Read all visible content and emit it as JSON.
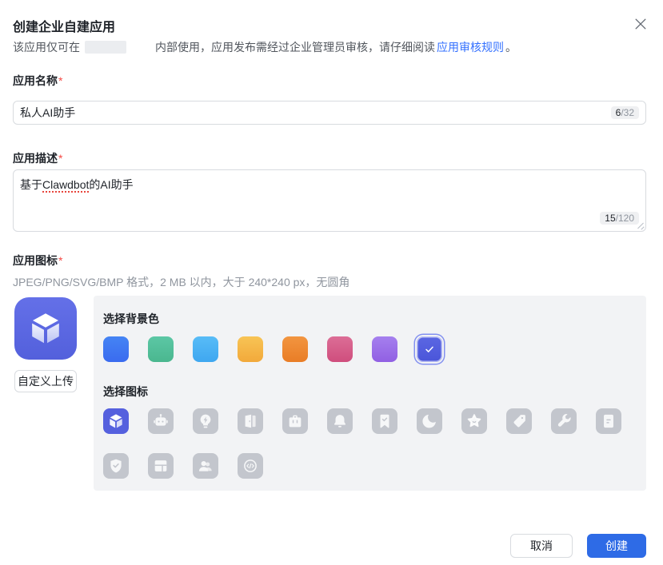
{
  "header": {
    "title": "创建企业自建应用",
    "subtitle_prefix": "该应用仅可在",
    "subtitle_suffix": "内部使用，应用发布需经过企业管理员审核，请仔细阅读",
    "subtitle_link": "应用审核规则",
    "subtitle_period": "。"
  },
  "name_field": {
    "label": "应用名称",
    "required": "*",
    "value": "私人AI助手",
    "count": "6",
    "limit": "/32"
  },
  "desc_field": {
    "label": "应用描述",
    "required": "*",
    "value_before": "基于",
    "value_marked": "Clawdbot",
    "value_after": "的AI助手",
    "count": "15",
    "limit": "/120"
  },
  "icon_field": {
    "label": "应用图标",
    "required": "*",
    "hint": "JPEG/PNG/SVG/BMP 格式，2 MB 以内，大于 240*240 px，无圆角",
    "upload_button": "自定义上传",
    "preview_icon": "cube-icon"
  },
  "picker": {
    "bg_color_title": "选择背景色",
    "icon_title": "选择图标",
    "colors": [
      {
        "name": "blue",
        "from": "#4584f4",
        "to": "#3a6bef"
      },
      {
        "name": "green",
        "from": "#5cc7a5",
        "to": "#4ab78f"
      },
      {
        "name": "sky",
        "from": "#58bcf7",
        "to": "#3fa7f0"
      },
      {
        "name": "amber",
        "from": "#f8c455",
        "to": "#f2a93b"
      },
      {
        "name": "orange",
        "from": "#f29540",
        "to": "#e97d26"
      },
      {
        "name": "rose",
        "from": "#dc6d96",
        "to": "#cf4e7d"
      },
      {
        "name": "purple",
        "from": "#a580ee",
        "to": "#9160e3"
      },
      {
        "name": "indigo",
        "from": "#5b67e3",
        "to": "#4a55d9"
      }
    ],
    "selected_color_index": 7,
    "check_icon": "check-icon",
    "icons": [
      "cube",
      "robot",
      "bulb",
      "door",
      "briefcase",
      "bell",
      "bookmark-check",
      "moon",
      "star",
      "tag",
      "wrench",
      "document",
      "shield-check",
      "layout",
      "users",
      "code"
    ],
    "selected_icon_index": 0
  },
  "footer": {
    "cancel_label": "取消",
    "create_label": "创建"
  },
  "colors": {
    "accent_blue": "#3370ff",
    "create_button": "#2e6be6",
    "selected_tile": "#5560de",
    "tile_grey": "#c3c6cd",
    "panel_bg": "#f2f3f5",
    "danger": "#f54a45"
  }
}
